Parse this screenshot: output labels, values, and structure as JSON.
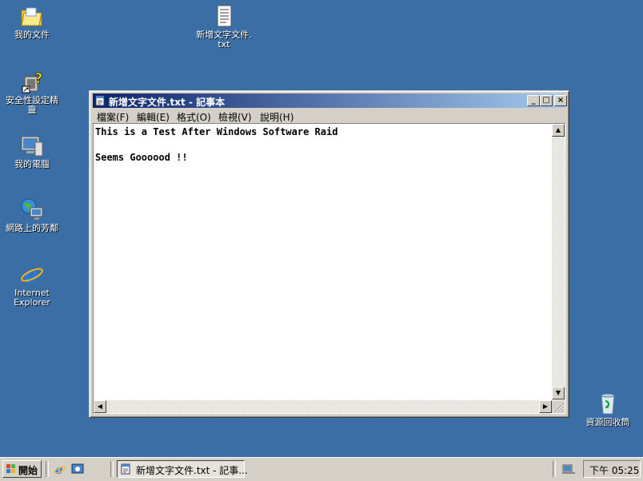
{
  "desktop": {
    "icons": [
      {
        "label": "我的文件"
      },
      {
        "label": "新增文字文件.\ntxt"
      },
      {
        "label": "安全性設定精\n靈"
      },
      {
        "label": "我的電腦"
      },
      {
        "label": "網路上的芳鄰"
      },
      {
        "label": "Internet\nExplorer"
      },
      {
        "label": "資源回收筒"
      }
    ]
  },
  "window": {
    "title": "新增文字文件.txt - 記事本",
    "buttons": {
      "minimize": "_",
      "maximize": "□",
      "close": "×"
    },
    "menu": [
      "檔案(F)",
      "編輯(E)",
      "格式(O)",
      "檢視(V)",
      "說明(H)"
    ],
    "content": "This is a Test After Windows Software Raid\n\nSeems Goooood !!"
  },
  "taskbar": {
    "start_label": "開始",
    "task_button_label": "新增文字文件.txt - 記事...",
    "clock": "下午 05:25"
  },
  "colors": {
    "desktop": "#3a6ea5",
    "titlebar_start": "#0a246a",
    "titlebar_end": "#a6caf0",
    "chrome": "#d4d0c8"
  }
}
